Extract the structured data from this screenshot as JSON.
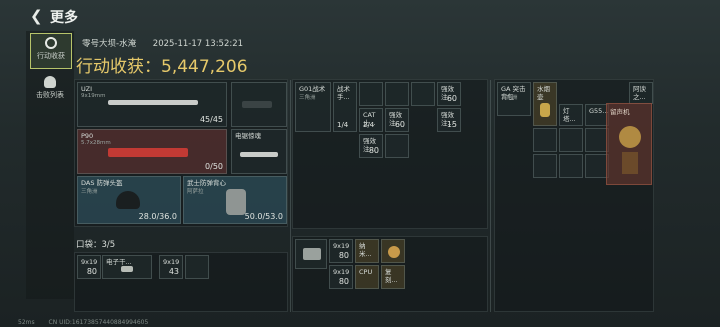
{
  "header": {
    "back_icon": "chevron-left-icon",
    "title": "更多"
  },
  "sidebar": {
    "items": [
      {
        "label": "行动收获",
        "icon": "target-icon",
        "active": true
      },
      {
        "label": "击败列表",
        "icon": "helmet-icon",
        "active": false
      }
    ]
  },
  "raid": {
    "map": "零号大坝-水淹",
    "datetime": "2025-11-17 13:52:21",
    "earnings_label": "行动收获：5,447,206"
  },
  "loadout": {
    "primary": {
      "name": "UZI",
      "sub": "9x19mm",
      "ammo": "45/45"
    },
    "pistol": {
      "name": ""
    },
    "secondary": {
      "name": "P90",
      "sub": "5.7x28mm",
      "ammo": "0/50"
    },
    "melee": {
      "name": "电锯惊魂"
    },
    "helmet": {
      "name": "DAS 防弹头盔",
      "sub": "三角洲",
      "durability": "28.0/36.0"
    },
    "armor": {
      "name": "武士防弹背心",
      "sub": "阿萨拉",
      "durability": "50.0/53.0"
    }
  },
  "pocket": {
    "title": "口袋：3/5",
    "items": [
      {
        "name": "9x19",
        "count": "80"
      },
      {
        "name": "电子干...",
        "count": ""
      },
      {
        "name": "9x19",
        "count": "43"
      }
    ]
  },
  "rig": {
    "items": [
      {
        "name": "G01战术",
        "sub": "三角洲",
        "count": ""
      },
      {
        "name": "战术手...",
        "count": "1/4"
      },
      {
        "name": "CAT止...",
        "count": "2/4"
      },
      {
        "name": "强效注...",
        "count": "60"
      },
      {
        "name": "强效注...",
        "count": "60"
      },
      {
        "name": "强效注...",
        "count": "15"
      },
      {
        "name": "强效注...",
        "count": "80"
      }
    ]
  },
  "backpack": {
    "items": [
      {
        "name": "9x19",
        "count": "80"
      },
      {
        "name": "纳米...",
        "count": ""
      },
      {
        "name": "9x19",
        "count": "80"
      },
      {
        "name": "CPU",
        "count": ""
      },
      {
        "name": "复刻...",
        "count": ""
      }
    ]
  },
  "case": {
    "items": [
      {
        "name": "GA 突击背包",
        "sub": "三角洲"
      },
      {
        "name": "水烟壶"
      },
      {
        "name": "灯塔...",
        "count": ""
      },
      {
        "name": "G55...",
        "count": ""
      },
      {
        "name": "阿谀之...",
        "count": ""
      },
      {
        "name": "留声机"
      }
    ]
  },
  "status": {
    "ping": "52ms",
    "cn_id": "CN UID:16173857440884994605"
  },
  "colors": {
    "accent": "#b7c46a",
    "earnings": "#e6c96a",
    "rare_red": "#6e342e"
  }
}
